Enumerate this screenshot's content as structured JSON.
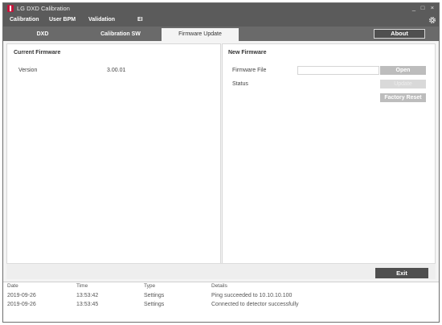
{
  "window": {
    "title": "LG DXD Calibration"
  },
  "window_controls": {
    "minimize": "_",
    "maximize": "□",
    "close": "×"
  },
  "menu": {
    "items": [
      "Calibration",
      "User BPM",
      "Validation",
      "EI"
    ]
  },
  "tabs": [
    "DXD",
    "Calibration SW",
    "Firmware Update"
  ],
  "active_tab": "Firmware Update",
  "about_button": "About",
  "current_firmware": {
    "title": "Current Firmware",
    "version_label": "Version",
    "version_value": "3.00.01"
  },
  "new_firmware": {
    "title": "New Firmware",
    "file_label": "Firmware File",
    "file_value": "",
    "status_label": "Status",
    "open_button": "Open",
    "update_button": "Update",
    "factory_reset_button": "Factory Reset"
  },
  "exit_button": "Exit",
  "log": {
    "columns": [
      "Date",
      "Time",
      "Type",
      "Details"
    ],
    "rows": [
      [
        "2019-09-26",
        "13:53:42",
        "Settings",
        "Ping succeeded to 10.10.10.100"
      ],
      [
        "2019-09-26",
        "13:53:45",
        "Settings",
        "Connected to detector successfully"
      ]
    ]
  },
  "colors": {
    "titlebar": "#5b5b5b",
    "tabbar": "#6a6a6a",
    "button_dark": "#4f4f4f",
    "button_gray": "#bdbdbd",
    "brand": "#c4163c"
  }
}
